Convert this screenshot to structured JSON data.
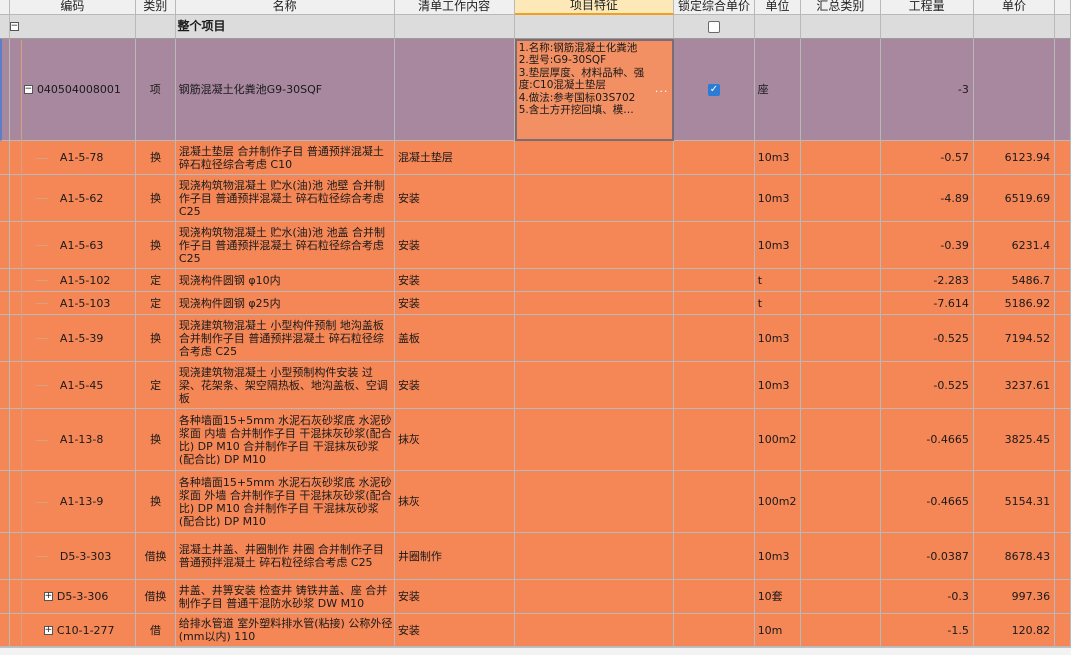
{
  "headers": [
    "编码",
    "类别",
    "名称",
    "清单工作内容",
    "项目特征",
    "锁定综合单价",
    "单位",
    "汇总类别",
    "工程量",
    "单价"
  ],
  "group": {
    "title": "整个项目",
    "toggle": "−"
  },
  "main_item": {
    "code": "040504008001",
    "type": "项",
    "name": "钢筋混凝土化粪池G9-30SQF",
    "spec": "1.名称:钢筋混凝土化粪池\n2.型号:G9-30SQF\n3.垫层厚度、材料品种、强度:C10混凝土垫层\n4.做法:参考国标03S702\n5.含土方开挖回填、模…",
    "spec_more": "···",
    "unit": "座",
    "quantity": "-3",
    "toggle": "−"
  },
  "items": [
    {
      "code": "A1-5-78",
      "type": "换",
      "name": "混凝土垫层  合并制作子目 普通预拌混凝土 碎石粒径综合考虑 C10",
      "work": "混凝土垫层",
      "unit": "10m3",
      "qty": "-0.57",
      "price": "6123.94"
    },
    {
      "code": "A1-5-62",
      "type": "换",
      "name": "现浇构筑物混凝土 贮水(油)池 池壁  合并制作子目 普通预拌混凝土 碎石粒径综合考虑 C25",
      "work": "安装",
      "unit": "10m3",
      "qty": "-4.89",
      "price": "6519.69"
    },
    {
      "code": "A1-5-63",
      "type": "换",
      "name": "现浇构筑物混凝土 贮水(油)池 池盖  合并制作子目 普通预拌混凝土 碎石粒径综合考虑 C25",
      "work": "安装",
      "unit": "10m3",
      "qty": "-0.39",
      "price": "6231.4"
    },
    {
      "code": "A1-5-102",
      "type": "定",
      "name": "现浇构件圆钢 φ10内",
      "work": "安装",
      "unit": "t",
      "qty": "-2.283",
      "price": "5486.7"
    },
    {
      "code": "A1-5-103",
      "type": "定",
      "name": "现浇构件圆钢 φ25内",
      "work": "安装",
      "unit": "t",
      "qty": "-7.614",
      "price": "5186.92"
    },
    {
      "code": "A1-5-39",
      "type": "换",
      "name": "现浇建筑物混凝土 小型构件预制 地沟盖板  合并制作子目 普通预拌混凝土 碎石粒径综合考虑 C25",
      "work": "盖板",
      "unit": "10m3",
      "qty": "-0.525",
      "price": "7194.52"
    },
    {
      "code": "A1-5-45",
      "type": "定",
      "name": "现浇建筑物混凝土 小型预制构件安装 过梁、花架条、架空隔热板、地沟盖板、空调板",
      "work": "安装",
      "unit": "10m3",
      "qty": "-0.525",
      "price": "3237.61"
    },
    {
      "code": "A1-13-8",
      "type": "换",
      "name": "各种墙面15+5mm 水泥石灰砂浆底 水泥砂浆面 内墙  合并制作子目 干混抹灰砂浆(配合比) DP M10  合并制作子目 干混抹灰砂浆(配合比) DP M10",
      "work": "抹灰",
      "unit": "100m2",
      "qty": "-0.4665",
      "price": "3825.45"
    },
    {
      "code": "A1-13-9",
      "type": "换",
      "name": "各种墙面15+5mm 水泥石灰砂浆底 水泥砂浆面 外墙  合并制作子目 干混抹灰砂浆(配合比) DP M10  合并制作子目 干混抹灰砂浆(配合比) DP M10",
      "work": "抹灰",
      "unit": "100m2",
      "qty": "-0.4665",
      "price": "5154.31"
    },
    {
      "code": "D5-3-303",
      "type": "借换",
      "name": "混凝土井盖、井圈制作 井圈  合并制作子目 普通预拌混凝土 碎石粒径综合考虑 C25",
      "work": "井圈制作",
      "unit": "10m3",
      "qty": "-0.0387",
      "price": "8678.43"
    },
    {
      "code": "D5-3-306",
      "type": "借换",
      "name": "井盖、井箅安装 检查井 铸铁井盖、座  合并制作子目 普通干混防水砂浆 DW M10",
      "work": "安装",
      "unit": "10套",
      "qty": "-0.3",
      "price": "997.36",
      "toggle": "+"
    },
    {
      "code": "C10-1-277",
      "type": "借",
      "name": "给排水管道 室外塑料排水管(粘接) 公称外径(mm以内) 110",
      "work": "安装",
      "unit": "10m",
      "qty": "-1.5",
      "price": "120.82",
      "toggle": "+"
    }
  ]
}
